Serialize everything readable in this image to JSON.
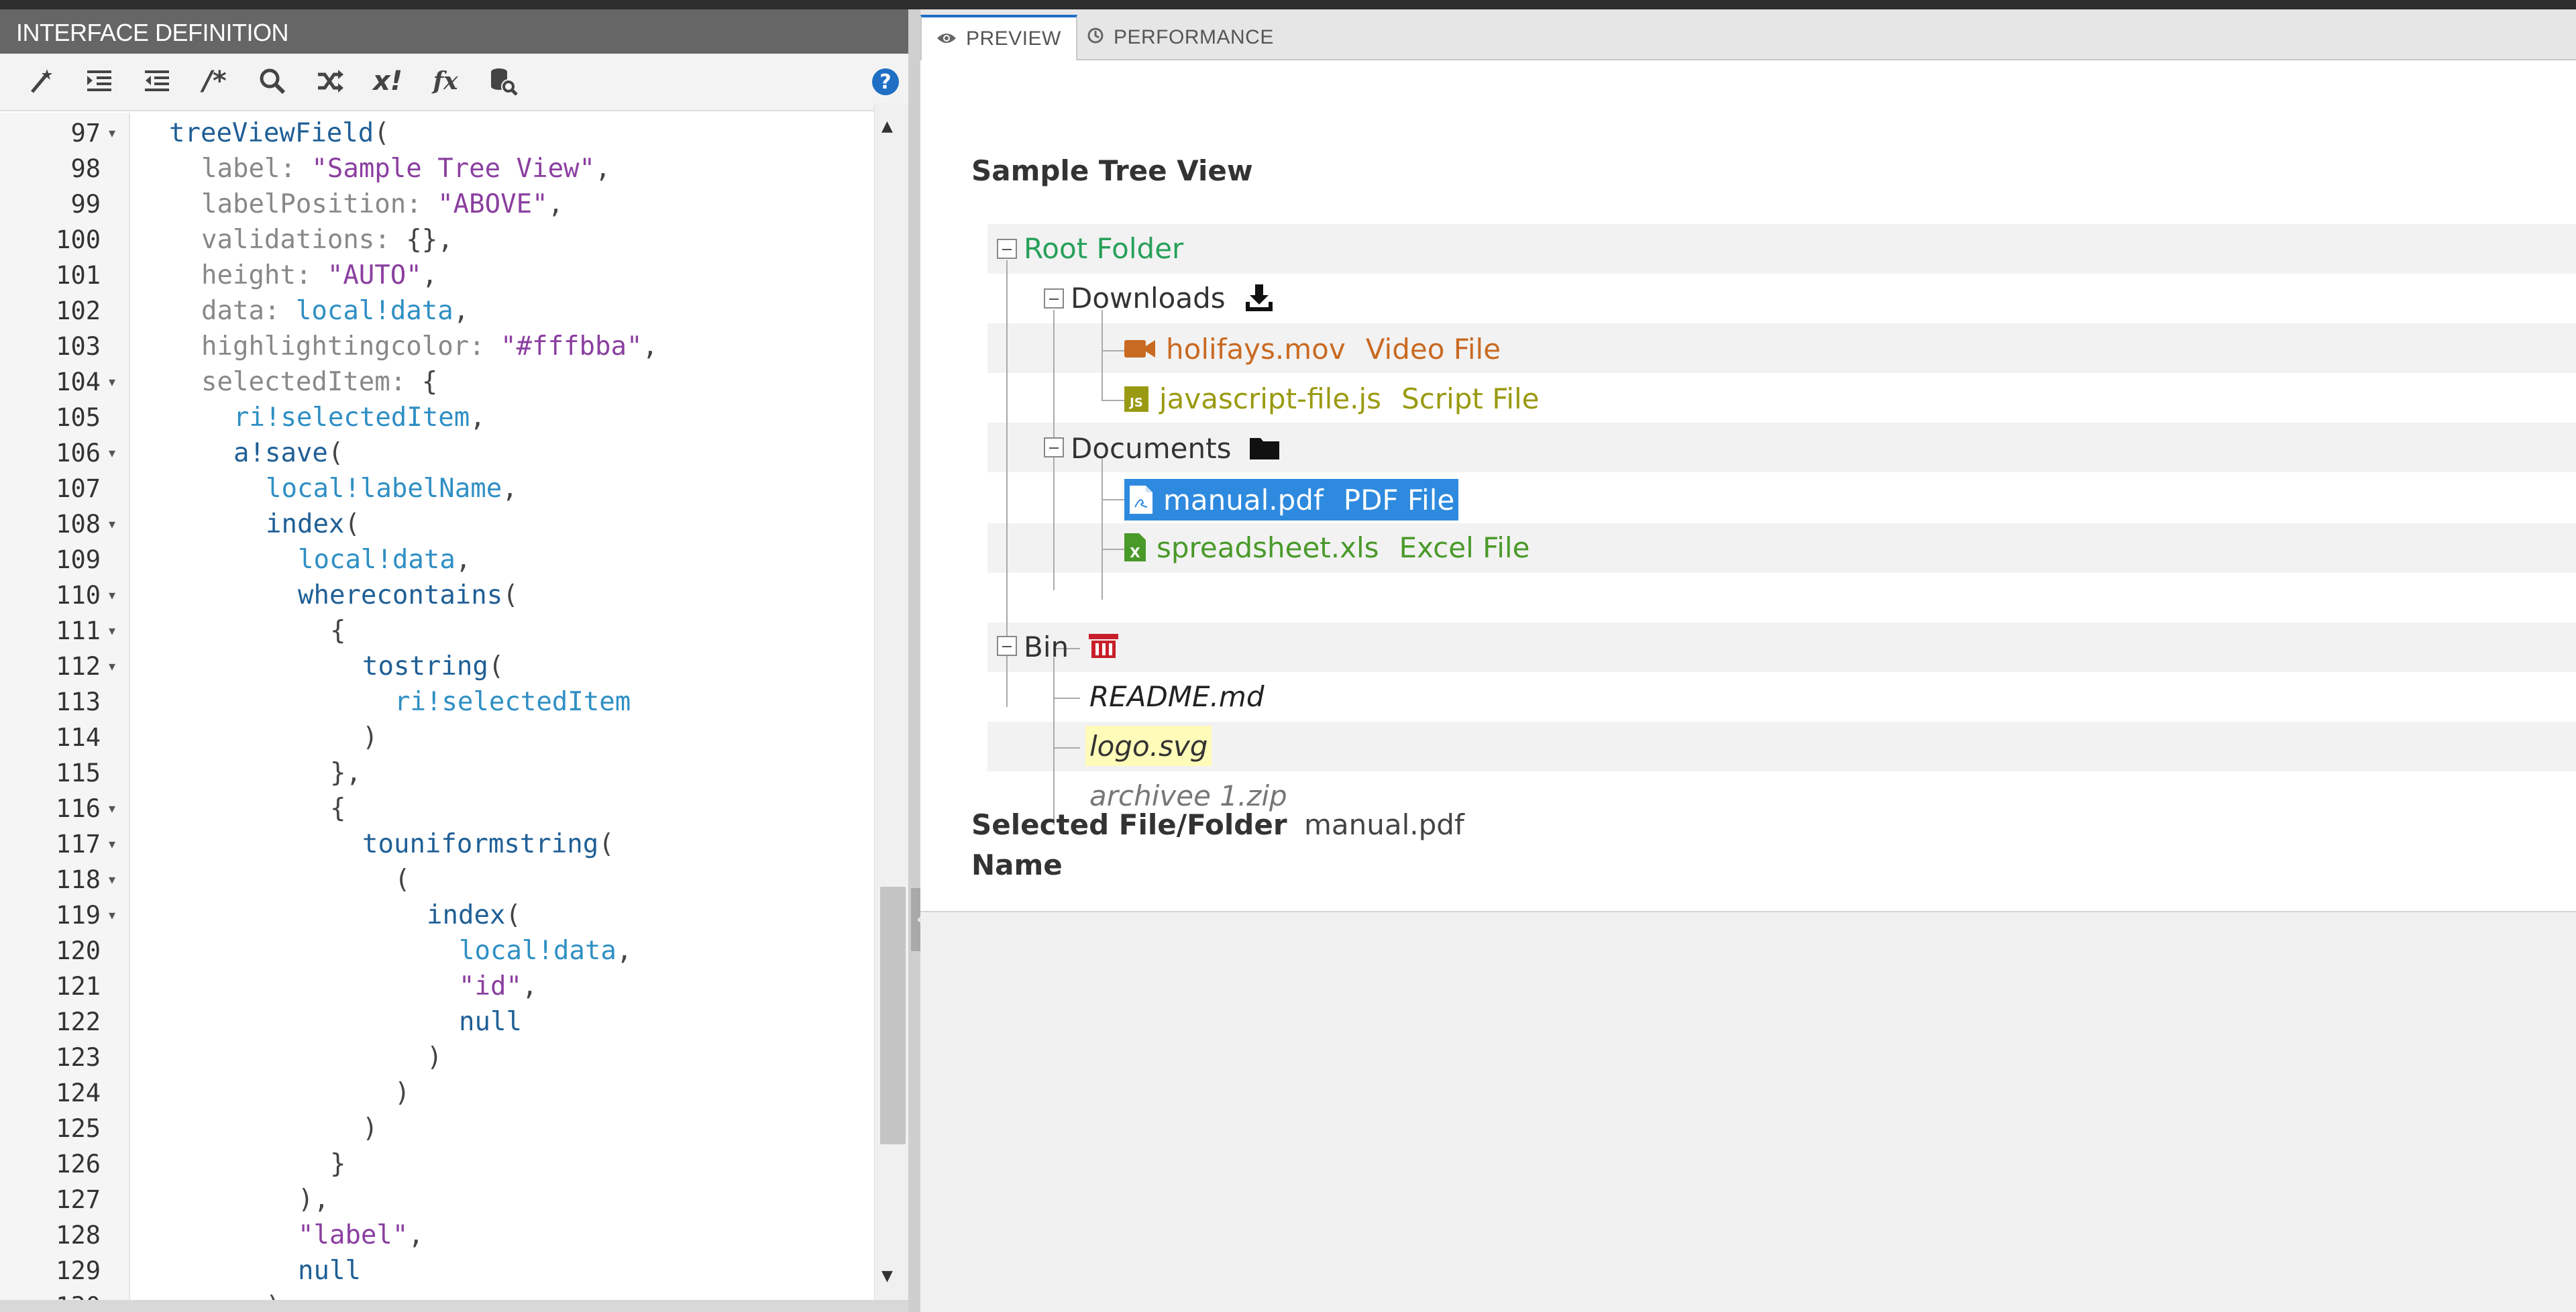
{
  "left_panel": {
    "title": "INTERFACE DEFINITION",
    "toolbar": [
      {
        "name": "format-icon",
        "glyph": ""
      },
      {
        "name": "indent-icon",
        "glyph": ""
      },
      {
        "name": "outdent-icon",
        "glyph": ""
      },
      {
        "name": "comment-icon",
        "glyph": "/*"
      },
      {
        "name": "search-icon",
        "glyph": ""
      },
      {
        "name": "shuffle-icon",
        "glyph": ""
      },
      {
        "name": "expression-error-icon",
        "glyph": "x!"
      },
      {
        "name": "function-icon",
        "glyph": "fx"
      },
      {
        "name": "database-search-icon",
        "glyph": ""
      }
    ],
    "help_glyph": "?",
    "code_lines": [
      {
        "n": "97",
        "fold": true,
        "indent": 2,
        "tokens": [
          [
            "fn",
            "treeViewField"
          ],
          [
            "p",
            "("
          ]
        ]
      },
      {
        "n": "98",
        "fold": false,
        "indent": 3,
        "tokens": [
          [
            "key",
            "label: "
          ],
          [
            "str",
            "\"Sample Tree View\""
          ],
          [
            "p",
            ","
          ]
        ]
      },
      {
        "n": "99",
        "fold": false,
        "indent": 3,
        "tokens": [
          [
            "key",
            "labelPosition: "
          ],
          [
            "str",
            "\"ABOVE\""
          ],
          [
            "p",
            ","
          ]
        ]
      },
      {
        "n": "100",
        "fold": false,
        "indent": 3,
        "tokens": [
          [
            "key",
            "validations: "
          ],
          [
            "p",
            "{},"
          ]
        ]
      },
      {
        "n": "101",
        "fold": false,
        "indent": 3,
        "tokens": [
          [
            "key",
            "height: "
          ],
          [
            "str",
            "\"AUTO\""
          ],
          [
            "p",
            ","
          ]
        ]
      },
      {
        "n": "102",
        "fold": false,
        "indent": 3,
        "tokens": [
          [
            "key",
            "data: "
          ],
          [
            "var",
            "local!data"
          ],
          [
            "p",
            ","
          ]
        ]
      },
      {
        "n": "103",
        "fold": false,
        "indent": 3,
        "tokens": [
          [
            "key",
            "highlightingcolor: "
          ],
          [
            "str",
            "\"#fffbba\""
          ],
          [
            "p",
            ","
          ]
        ]
      },
      {
        "n": "104",
        "fold": true,
        "indent": 3,
        "tokens": [
          [
            "key",
            "selectedItem: "
          ],
          [
            "p",
            "{"
          ]
        ]
      },
      {
        "n": "105",
        "fold": false,
        "indent": 4,
        "tokens": [
          [
            "var",
            "ri!selectedItem"
          ],
          [
            "p",
            ","
          ]
        ]
      },
      {
        "n": "106",
        "fold": true,
        "indent": 4,
        "tokens": [
          [
            "fn",
            "a!save"
          ],
          [
            "p",
            "("
          ]
        ]
      },
      {
        "n": "107",
        "fold": false,
        "indent": 5,
        "tokens": [
          [
            "var",
            "local!labelName"
          ],
          [
            "p",
            ","
          ]
        ]
      },
      {
        "n": "108",
        "fold": true,
        "indent": 5,
        "tokens": [
          [
            "fn",
            "index"
          ],
          [
            "p",
            "("
          ]
        ]
      },
      {
        "n": "109",
        "fold": false,
        "indent": 6,
        "tokens": [
          [
            "var",
            "local!data"
          ],
          [
            "p",
            ","
          ]
        ]
      },
      {
        "n": "110",
        "fold": true,
        "indent": 6,
        "tokens": [
          [
            "fn",
            "wherecontains"
          ],
          [
            "p",
            "("
          ]
        ]
      },
      {
        "n": "111",
        "fold": true,
        "indent": 7,
        "tokens": [
          [
            "p",
            "{"
          ]
        ]
      },
      {
        "n": "112",
        "fold": true,
        "indent": 8,
        "tokens": [
          [
            "fn",
            "tostring"
          ],
          [
            "p",
            "("
          ]
        ]
      },
      {
        "n": "113",
        "fold": false,
        "indent": 9,
        "tokens": [
          [
            "var",
            "ri!selectedItem"
          ]
        ]
      },
      {
        "n": "114",
        "fold": false,
        "indent": 8,
        "tokens": [
          [
            "p",
            ")"
          ]
        ]
      },
      {
        "n": "115",
        "fold": false,
        "indent": 7,
        "tokens": [
          [
            "p",
            "},"
          ]
        ]
      },
      {
        "n": "116",
        "fold": true,
        "indent": 7,
        "tokens": [
          [
            "p",
            "{"
          ]
        ]
      },
      {
        "n": "117",
        "fold": true,
        "indent": 8,
        "tokens": [
          [
            "fn",
            "touniformstring"
          ],
          [
            "p",
            "("
          ]
        ]
      },
      {
        "n": "118",
        "fold": true,
        "indent": 9,
        "tokens": [
          [
            "p",
            "("
          ]
        ]
      },
      {
        "n": "119",
        "fold": true,
        "indent": 10,
        "tokens": [
          [
            "fn",
            "index"
          ],
          [
            "p",
            "("
          ]
        ]
      },
      {
        "n": "120",
        "fold": false,
        "indent": 11,
        "tokens": [
          [
            "var",
            "local!data"
          ],
          [
            "p",
            ","
          ]
        ]
      },
      {
        "n": "121",
        "fold": false,
        "indent": 11,
        "tokens": [
          [
            "str",
            "\"id\""
          ],
          [
            "p",
            ","
          ]
        ]
      },
      {
        "n": "122",
        "fold": false,
        "indent": 11,
        "tokens": [
          [
            "fn",
            "null"
          ]
        ]
      },
      {
        "n": "123",
        "fold": false,
        "indent": 10,
        "tokens": [
          [
            "p",
            ")"
          ]
        ]
      },
      {
        "n": "124",
        "fold": false,
        "indent": 9,
        "tokens": [
          [
            "p",
            ")"
          ]
        ]
      },
      {
        "n": "125",
        "fold": false,
        "indent": 8,
        "tokens": [
          [
            "p",
            ")"
          ]
        ]
      },
      {
        "n": "126",
        "fold": false,
        "indent": 7,
        "tokens": [
          [
            "p",
            "}"
          ]
        ]
      },
      {
        "n": "127",
        "fold": false,
        "indent": 6,
        "tokens": [
          [
            "p",
            "),"
          ]
        ]
      },
      {
        "n": "128",
        "fold": false,
        "indent": 6,
        "tokens": [
          [
            "str",
            "\"label\""
          ],
          [
            "p",
            ","
          ]
        ]
      },
      {
        "n": "129",
        "fold": false,
        "indent": 6,
        "tokens": [
          [
            "fn",
            "null"
          ]
        ]
      },
      {
        "n": "130",
        "fold": false,
        "indent": 5,
        "tokens": [
          [
            "p",
            ")"
          ]
        ]
      }
    ]
  },
  "right_panel": {
    "tabs": [
      {
        "label": "PREVIEW",
        "icon": "eye-icon",
        "active": true
      },
      {
        "label": "PERFORMANCE",
        "icon": "clock-icon",
        "active": false
      }
    ],
    "field_label": "Sample Tree View",
    "tree": [
      {
        "id": "root",
        "label": "Root Folder",
        "desc": "",
        "color": "#27a05a"
      },
      {
        "id": "downloads",
        "label": "Downloads",
        "desc": "",
        "color": "#333333",
        "icon": "download-icon"
      },
      {
        "id": "holifays",
        "label": "holifays.mov",
        "desc": "Video File",
        "color": "#c96a22",
        "icon": "video-icon"
      },
      {
        "id": "jsfile",
        "label": "javascript-file.js",
        "desc": "Script File",
        "color": "#9a9a12",
        "icon": "js-file-icon"
      },
      {
        "id": "documents",
        "label": "Documents",
        "desc": "",
        "color": "#333333",
        "icon": "folder-icon"
      },
      {
        "id": "manual",
        "label": "manual.pdf",
        "desc": "PDF File",
        "color": "#ffffff",
        "icon": "pdf-file-icon"
      },
      {
        "id": "spreadsheet",
        "label": "spreadsheet.xls",
        "desc": "Excel File",
        "color": "#4a9a2a",
        "icon": "excel-file-icon"
      },
      {
        "id": "bin",
        "label": "Bin",
        "desc": "",
        "color": "#333333",
        "icon": "bin-icon"
      },
      {
        "id": "readme",
        "label": "README.md",
        "desc": "",
        "color": "#222222"
      },
      {
        "id": "logo",
        "label": "logo.svg",
        "desc": "",
        "color": "#333333"
      },
      {
        "id": "archive",
        "label": "archivee 1.zip",
        "desc": "",
        "color": "#777777"
      }
    ],
    "selected_label": "Selected File/Folder Name",
    "selected_value": "manual.pdf",
    "colors": {
      "selection": "#2e8ade",
      "highlight": "#fffbb8",
      "accent": "#1f6fc5"
    }
  }
}
